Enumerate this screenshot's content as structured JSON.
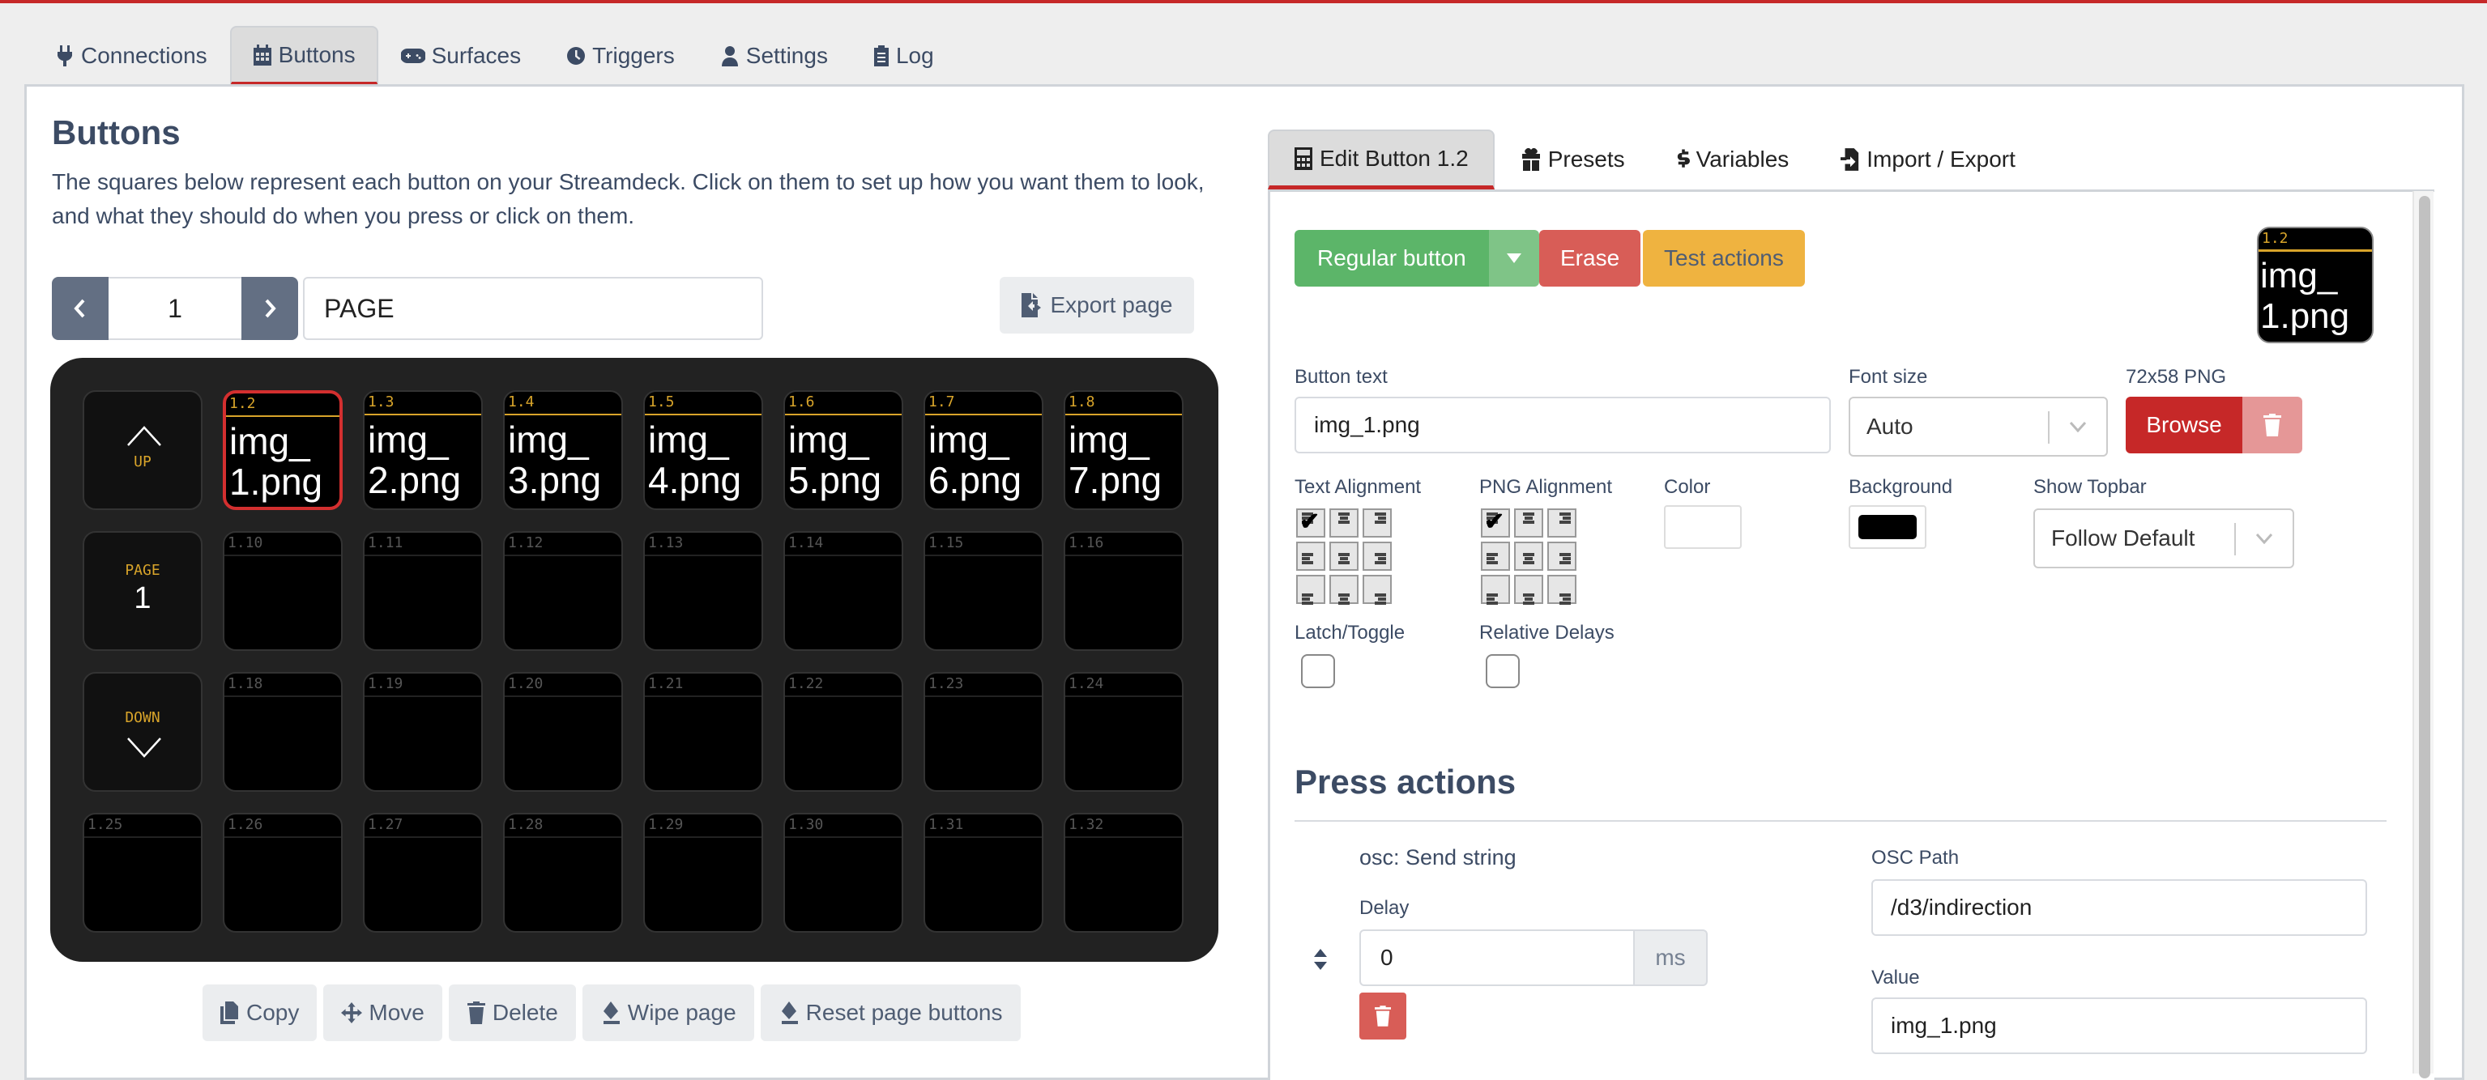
{
  "nav": {
    "tabs": [
      {
        "label": "Connections",
        "icon": "plug-icon",
        "active": false
      },
      {
        "label": "Buttons",
        "icon": "calendar-grid-icon",
        "active": true
      },
      {
        "label": "Surfaces",
        "icon": "gamepad-icon",
        "active": false
      },
      {
        "label": "Triggers",
        "icon": "clock-icon",
        "active": false
      },
      {
        "label": "Settings",
        "icon": "user-gear-icon",
        "active": false
      },
      {
        "label": "Log",
        "icon": "clipboard-list-icon",
        "active": false
      }
    ]
  },
  "buttons_panel": {
    "title": "Buttons",
    "description": "The squares below represent each button on your Streamdeck. Click on them to set up how you want them to look, and what they should do when you press or click on them.",
    "page_number": "1",
    "page_name": "PAGE",
    "export_label": "Export page",
    "nav_keys": {
      "up_label": "UP",
      "page_label": "PAGE",
      "page_value": "1",
      "down_label": "DOWN"
    },
    "grid": [
      [
        {
          "id": "1.2",
          "text": "img_\n1.png",
          "selected": true
        },
        {
          "id": "1.3",
          "text": "img_\n2.png"
        },
        {
          "id": "1.4",
          "text": "img_\n3.png"
        },
        {
          "id": "1.5",
          "text": "img_\n4.png"
        },
        {
          "id": "1.6",
          "text": "img_\n5.png"
        },
        {
          "id": "1.7",
          "text": "img_\n6.png"
        },
        {
          "id": "1.8",
          "text": "img_\n7.png"
        }
      ],
      [
        {
          "id": "1.10"
        },
        {
          "id": "1.11"
        },
        {
          "id": "1.12"
        },
        {
          "id": "1.13"
        },
        {
          "id": "1.14"
        },
        {
          "id": "1.15"
        },
        {
          "id": "1.16"
        }
      ],
      [
        {
          "id": "1.18"
        },
        {
          "id": "1.19"
        },
        {
          "id": "1.20"
        },
        {
          "id": "1.21"
        },
        {
          "id": "1.22"
        },
        {
          "id": "1.23"
        },
        {
          "id": "1.24"
        }
      ],
      [
        {
          "id": "1.25"
        },
        {
          "id": "1.26"
        },
        {
          "id": "1.27"
        },
        {
          "id": "1.28"
        },
        {
          "id": "1.29"
        },
        {
          "id": "1.30"
        },
        {
          "id": "1.31"
        },
        {
          "id": "1.32"
        }
      ]
    ],
    "actions": {
      "copy": "Copy",
      "move": "Move",
      "delete": "Delete",
      "wipe": "Wipe page",
      "reset": "Reset page buttons"
    }
  },
  "editor": {
    "tabs": [
      {
        "label": "Edit Button 1.2",
        "icon": "calculator-icon",
        "active": true
      },
      {
        "label": "Presets",
        "icon": "gift-icon",
        "active": false
      },
      {
        "label": "Variables",
        "icon": "dollar-icon",
        "active": false
      },
      {
        "label": "Import / Export",
        "icon": "file-import-icon",
        "active": false
      }
    ],
    "button_type": "Regular button",
    "erase_label": "Erase",
    "test_label": "Test actions",
    "preview": {
      "id": "1.2",
      "text": "img_\n1.png"
    },
    "button_text_label": "Button text",
    "button_text_value": "img_1.png",
    "font_size_label": "Font size",
    "font_size_value": "Auto",
    "png_label": "72x58 PNG",
    "browse_label": "Browse",
    "text_alignment_label": "Text Alignment",
    "png_alignment_label": "PNG Alignment",
    "text_alignment_selected": "top-left",
    "png_alignment_selected": "top-left",
    "color_label": "Color",
    "color_value": "#ffffff",
    "background_label": "Background",
    "background_value": "#000000",
    "show_topbar_label": "Show Topbar",
    "show_topbar_value": "Follow Default",
    "latch_label": "Latch/Toggle",
    "latch_checked": false,
    "relative_delays_label": "Relative Delays",
    "relative_delays_checked": false,
    "press_actions_title": "Press actions",
    "action": {
      "name": "osc: Send string",
      "delay_label": "Delay",
      "delay_value": "0",
      "delay_unit": "ms",
      "osc_path_label": "OSC Path",
      "osc_path_value": "/d3/indirection",
      "value_label": "Value",
      "value_value": "img_1.png"
    }
  }
}
